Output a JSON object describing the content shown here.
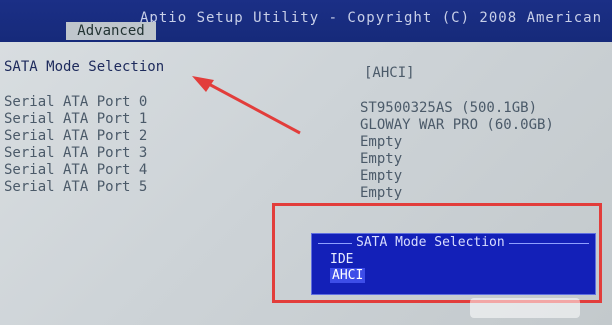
{
  "header": {
    "app_title": "Aptio Setup Utility - Copyright (C) 2008 American",
    "active_tab": "Advanced"
  },
  "settings": {
    "sata_mode_label": "SATA Mode Selection",
    "sata_mode_value": "[AHCI]",
    "ports": [
      {
        "label": "Serial ATA Port 0",
        "value": "ST9500325AS      (500.1GB)"
      },
      {
        "label": "Serial ATA Port 1",
        "value": "GLOWAY WAR PRO (60.0GB)"
      },
      {
        "label": "Serial ATA Port 2",
        "value": "Empty"
      },
      {
        "label": "Serial ATA Port 3",
        "value": "Empty"
      },
      {
        "label": "Serial ATA Port 4",
        "value": "Empty"
      },
      {
        "label": "Serial ATA Port 5",
        "value": "Empty"
      }
    ]
  },
  "popup": {
    "title": "SATA Mode Selection",
    "options": [
      "IDE",
      "AHCI"
    ],
    "selected": "AHCI"
  },
  "annotation_color": "#e23d3b"
}
